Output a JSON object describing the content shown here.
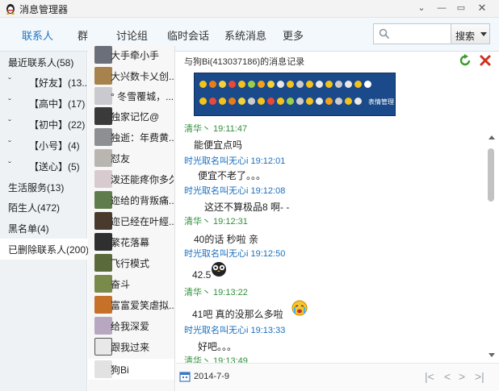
{
  "window": {
    "title": "消息管理器",
    "minimize": "⌄",
    "maximize": "—",
    "restore": "▭",
    "close": "✕"
  },
  "nav": {
    "tabs": [
      "联系人",
      "群",
      "讨论组",
      "临时会话",
      "系统消息",
      "更多"
    ],
    "active_index": 0,
    "search_placeholder": "",
    "search_button": "搜索"
  },
  "categories": [
    {
      "label": "最近联系人(58)",
      "sub": false
    },
    {
      "label": "【好友】(13...",
      "sub": true
    },
    {
      "label": "【高中】(17)",
      "sub": true
    },
    {
      "label": "【初中】(22)",
      "sub": true
    },
    {
      "label": "【小号】(4)",
      "sub": true
    },
    {
      "label": "【送心】(5)",
      "sub": true
    },
    {
      "label": "生活服务(13)",
      "sub": false
    },
    {
      "label": "陌生人(472)",
      "sub": false
    },
    {
      "label": "黑名单(4)",
      "sub": false
    },
    {
      "label": "已删除联系人(200)",
      "sub": false,
      "selected": true
    }
  ],
  "category_arrow": "ˇ",
  "contacts": [
    {
      "name": "大手牵小手"
    },
    {
      "name": "大兴数卡乂创..."
    },
    {
      "name": "° 冬雪覆城，..."
    },
    {
      "name": "独家记忆@"
    },
    {
      "name": "独逝：年费黄..."
    },
    {
      "name": "怼友"
    },
    {
      "name": "泼还能疼你多久"
    },
    {
      "name": "迩给的背叛痛..."
    },
    {
      "name": "迩已经在叶經..."
    },
    {
      "name": "繁花落幕"
    },
    {
      "name": "飞行模式"
    },
    {
      "name": "奋斗"
    },
    {
      "name": "富富爱笑虐拟..."
    },
    {
      "name": "给我深爱"
    },
    {
      "name": "跟我过来"
    },
    {
      "name": "狗Bi",
      "selected": true
    }
  ],
  "chat": {
    "header": "与狗Bi(413037186)的消息记录",
    "emoji_manager_label": "表情管理",
    "messages": [
      {
        "sender": "清华丶 19:11:47",
        "color": "green",
        "text": "能便宜点吗"
      },
      {
        "sender": "时光取名叫无心i 19:12:01",
        "color": "blue",
        "text": "便宜不老了。。。"
      },
      {
        "sender": "时光取名叫无心i 19:12:08",
        "color": "blue",
        "text": "这还不算极品8 啊- -"
      },
      {
        "sender": "清华丶 19:12:31",
        "color": "green",
        "text": "40的话 秒啦 亲"
      },
      {
        "sender": "时光取名叫无心i 19:12:50",
        "color": "blue",
        "text": "42.5"
      },
      {
        "sender": "清华丶 19:13:22",
        "color": "green",
        "text": "41吧   真的没那么多啦"
      },
      {
        "sender": "时光取名叫无心i 19:13:33",
        "color": "blue",
        "text": "好吧。。。"
      },
      {
        "sender": "清华丶 19:13:49",
        "color": "green",
        "text": ""
      }
    ],
    "date": "2014-7-9",
    "pager": {
      "first": "|<",
      "prev": "<",
      "next": ">",
      "last": ">|"
    }
  },
  "colors": {
    "accent": "#1e73be",
    "green_sender": "#2f8f3a",
    "blue_sender": "#1a6fbf",
    "emoji_panel": "#1a4a8a"
  }
}
